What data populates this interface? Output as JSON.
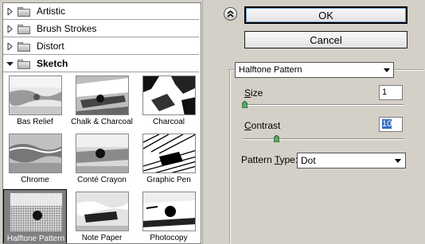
{
  "categories": [
    {
      "label": "Artistic",
      "expanded": false
    },
    {
      "label": "Brush Strokes",
      "expanded": false
    },
    {
      "label": "Distort",
      "expanded": false
    },
    {
      "label": "Sketch",
      "expanded": true
    }
  ],
  "thumbnails": [
    {
      "label": "Bas Relief",
      "selected": false
    },
    {
      "label": "Chalk & Charcoal",
      "selected": false
    },
    {
      "label": "Charcoal",
      "selected": false
    },
    {
      "label": "Chrome",
      "selected": false
    },
    {
      "label": "Conté Crayon",
      "selected": false
    },
    {
      "label": "Graphic Pen",
      "selected": false
    },
    {
      "label": "Halftone Pattern",
      "selected": true
    },
    {
      "label": "Note Paper",
      "selected": false
    },
    {
      "label": "Photocopy",
      "selected": false
    }
  ],
  "buttons": {
    "ok": "OK",
    "cancel": "Cancel"
  },
  "filter_select": {
    "value": "Halftone Pattern"
  },
  "params": {
    "size": {
      "label_u": "S",
      "label_rest": "ize",
      "value": "1",
      "slider_fraction": 0.0
    },
    "contrast": {
      "label_u": "C",
      "label_rest": "ontrast",
      "value": "10",
      "slider_fraction": 0.2
    }
  },
  "pattern_type": {
    "label_pre": "Pattern ",
    "label_u": "T",
    "label_rest": "ype:",
    "value": "Dot"
  }
}
